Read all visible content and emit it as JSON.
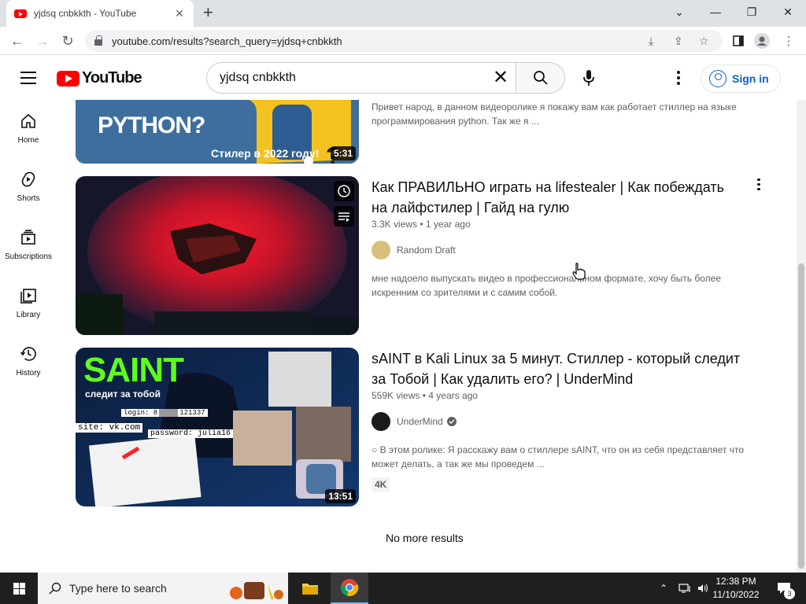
{
  "browser": {
    "tab_title": "yjdsq cnbkkth - YouTube",
    "url": "youtube.com/results?search_query=yjdsq+cnbkkth"
  },
  "header": {
    "logo_text": "YouTube",
    "search_query": "yjdsq cnbkkth",
    "signin_label": "Sign in"
  },
  "sidebar": {
    "items": [
      {
        "label": "Home",
        "icon": "home-icon"
      },
      {
        "label": "Shorts",
        "icon": "shorts-icon"
      },
      {
        "label": "Subscriptions",
        "icon": "subscriptions-icon"
      },
      {
        "label": "Library",
        "icon": "library-icon"
      },
      {
        "label": "History",
        "icon": "history-icon"
      }
    ]
  },
  "results": [
    {
      "thumb_text": "PYTHON?",
      "thumb_subtext": "Стилер в 2022 году!",
      "duration": "5:31",
      "description": "Привет народ, в данном видеоролике я покажу вам как работает стиллер на языке программирования python. Так же я ..."
    },
    {
      "title": "Как ПРАВИЛЬНО играть на lifestealer | Как побеждать на лайфстилер | Гайд на гулю",
      "views": "3.3K views",
      "age": "1 year ago",
      "channel": "Random Draft",
      "description": "мне надоело выпускать видео в профессиональном формате, хочу быть более искренним со зрителями и с самим собой."
    },
    {
      "title": "sAINT в Kali Linux за 5 минут. Стиллер - который следит за Тобой | Как удалить его? | UnderMind",
      "views": "559K views",
      "age": "4 years ago",
      "channel": "UnderMind",
      "duration": "13:51",
      "thumb_text": "SAINT",
      "thumb_subtext": "следит за тобой",
      "thumb_login": "login: 8",
      "thumb_login_tail": "121337",
      "thumb_site": "site: vk.com",
      "thumb_password": "password: julia16",
      "description": "○ В этом ролике: Я расскажу вам о стиллере sAINT, что он из себя представляет что может делать, а так же мы проведем ...",
      "badge": "4K"
    }
  ],
  "end_message": "No more results",
  "taskbar": {
    "search_placeholder": "Type here to search",
    "time": "12:38 PM",
    "date": "11/10/2022",
    "notification_count": "3"
  }
}
